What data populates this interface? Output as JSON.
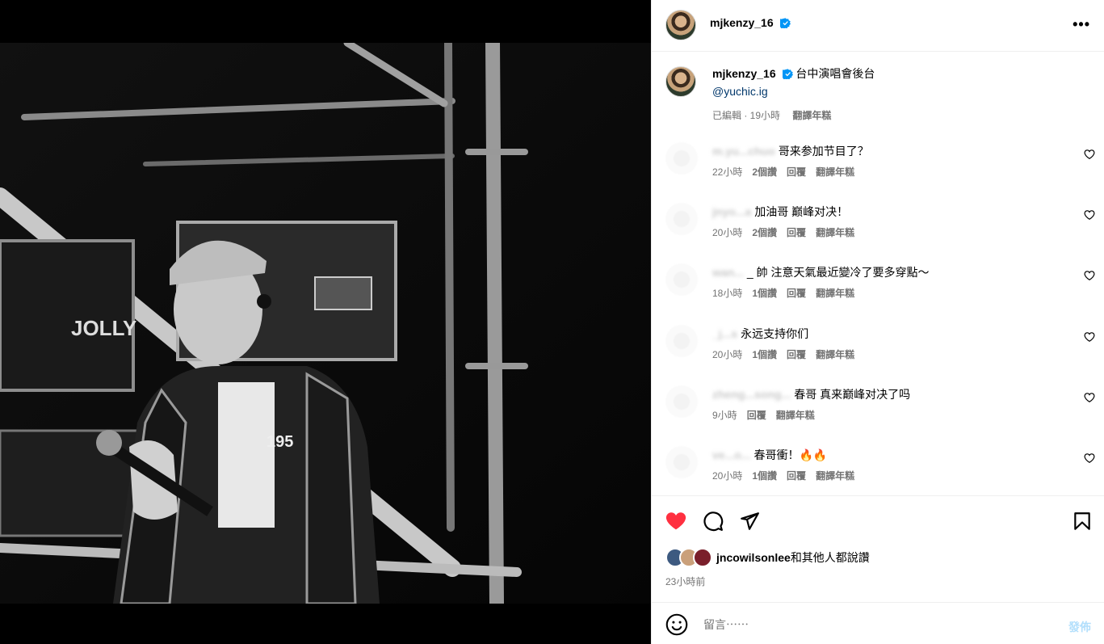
{
  "post": {
    "author": "mjkenzy_16",
    "more_label": "•••",
    "caption_text": "台中演唱會後台",
    "caption_mention": "@yuchic.ig",
    "caption_edited": "已編輯 · 19小時",
    "caption_translate": "翻譯年糕"
  },
  "comments": [
    {
      "author": "m.yu...chuo",
      "text": "哥来参加节目了？",
      "time": "22小時",
      "likes": "2個讚",
      "reply": "回覆",
      "translate": "翻譯年糕"
    },
    {
      "author": "jnyo...a",
      "text": "加油哥 巅峰对决！",
      "time": "20小時",
      "likes": "2個讚",
      "reply": "回覆",
      "translate": "翻譯年糕"
    },
    {
      "author": "wan...",
      "text": "_ 帥 注意天氣最近變冷了要多穿點～",
      "time": "18小時",
      "likes": "1個讚",
      "reply": "回覆",
      "translate": "翻譯年糕"
    },
    {
      "author": "_j...s",
      "text": "永远支持你们",
      "time": "20小時",
      "likes": "1個讚",
      "reply": "回覆",
      "translate": "翻譯年糕"
    },
    {
      "author": "zheng...song...",
      "text": "春哥 真来巅峰对决了吗",
      "time": "9小時",
      "likes": "",
      "reply": "回覆",
      "translate": "翻譯年糕"
    },
    {
      "author": "ve...o...",
      "text": "春哥衝！🔥🔥",
      "time": "20小時",
      "likes": "1個讚",
      "reply": "回覆",
      "translate": "翻譯年糕"
    }
  ],
  "likes_summary": {
    "user": "jncowilsonlee",
    "suffix": "和其他人都說讚"
  },
  "post_time": "23小時前",
  "composer": {
    "placeholder": "留言⋯⋯",
    "post_label": "發佈"
  },
  "colors": {
    "like_red": "#ff3040",
    "link_blue": "#00376b",
    "verified_blue": "#0095f6",
    "post_disabled": "#b2dffc",
    "meta_gray": "#737373"
  },
  "icons": [
    "verified-icon",
    "more-icon",
    "heart-icon",
    "comment-icon",
    "share-icon",
    "bookmark-icon",
    "emoji-icon"
  ]
}
